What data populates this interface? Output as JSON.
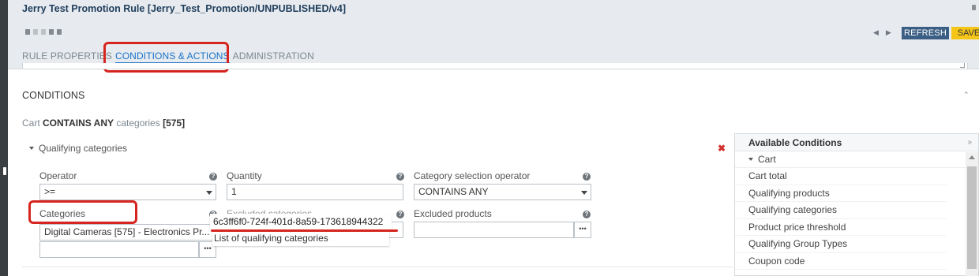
{
  "window": {
    "title": "Jerry Test Promotion Rule [Jerry_Test_Promotion/UNPUBLISHED/v4]"
  },
  "toolbar": {
    "refresh_label": "REFRESH",
    "save_label": "SAVE",
    "prev_arrow": "◀",
    "next_arrow": "▶"
  },
  "tabs": [
    {
      "label": "RULE PROPERTIES"
    },
    {
      "label": "CONDITIONS & ACTIONS"
    },
    {
      "label": "ADMINISTRATION"
    }
  ],
  "conditions": {
    "section_title": "CONDITIONS",
    "collapse_glyph": "⌃",
    "summary": {
      "prefix": "Cart",
      "operator": "CONTAINS ANY",
      "noun": "categories",
      "value": "[575]"
    },
    "group_label": "Qualifying categories",
    "remove_glyph": "✖",
    "fields": {
      "operator_label": "Operator",
      "operator_value": ">=",
      "quantity_label": "Quantity",
      "quantity_value": "1",
      "cat_sel_label": "Category selection operator",
      "cat_sel_value": "CONTAINS ANY",
      "categories_label": "Categories",
      "categories_value": "Digital Cameras [575] - Electronics Pr...",
      "excluded_categories_label": "Excluded categories",
      "excluded_products_label": "Excluded products",
      "help_glyph": "?",
      "dots_label": "•••"
    },
    "tooltip": {
      "id": "6c3ff6f0-724f-401d-8a59-173618944322",
      "description": "List of qualifying categories"
    }
  },
  "available_conditions": {
    "title": "Available Conditions",
    "expand_glyph": "»",
    "group": "Cart",
    "items": [
      {
        "label": "Cart total"
      },
      {
        "label": "Qualifying products"
      },
      {
        "label": "Qualifying categories"
      },
      {
        "label": "Product price threshold"
      },
      {
        "label": "Qualifying Group Types"
      },
      {
        "label": "Coupon code"
      }
    ]
  },
  "colors": {
    "header_bg": "#e7ebef",
    "title_color": "#1f3d5b",
    "refresh_bg": "#3b5e84",
    "save_bg": "#f5c518",
    "active_tab": "#1a73c9",
    "annotation_red": "#d6251f"
  }
}
